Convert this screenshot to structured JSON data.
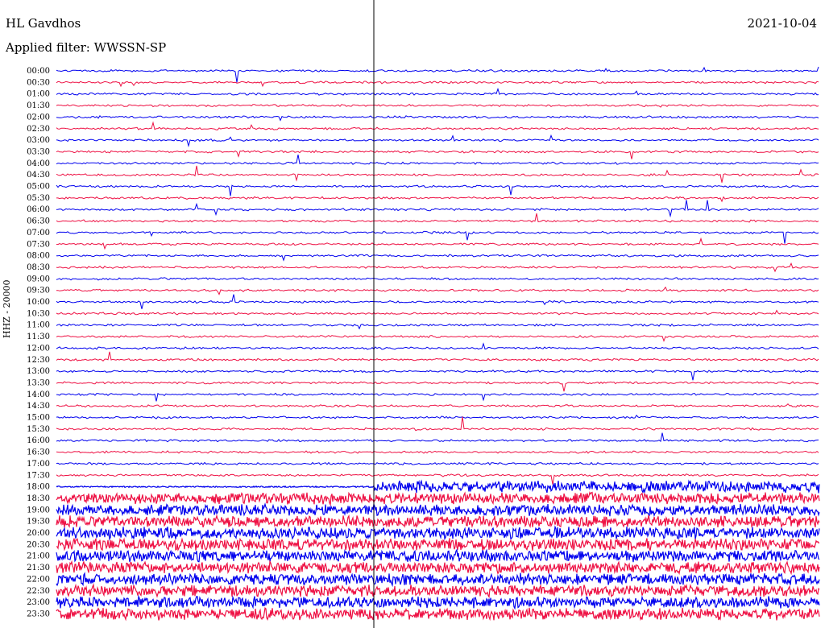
{
  "header": {
    "station": "HL Gavdhos",
    "filter": "Applied filter: WWSSN-SP",
    "date": "2021-10-04",
    "channel": "HHZ - 20000"
  },
  "colors": {
    "even_trace": "#0000ee",
    "odd_trace": "#ee1144",
    "cursor_line": "#000000"
  },
  "time_labels": [
    "00:00",
    "00:30",
    "01:00",
    "01:30",
    "02:00",
    "02:30",
    "03:00",
    "03:30",
    "04:00",
    "04:30",
    "05:00",
    "05:30",
    "06:00",
    "06:30",
    "07:00",
    "07:30",
    "08:00",
    "08:30",
    "09:00",
    "09:30",
    "10:00",
    "10:30",
    "11:00",
    "11:30",
    "12:00",
    "12:30",
    "13:00",
    "13:30",
    "14:00",
    "14:30",
    "15:00",
    "15:30",
    "16:00",
    "16:30",
    "17:00",
    "17:30",
    "18:00",
    "18:30",
    "19:00",
    "19:30",
    "20:00",
    "20:30",
    "21:00",
    "21:30",
    "22:00",
    "22:30",
    "23:00",
    "23:30"
  ]
}
